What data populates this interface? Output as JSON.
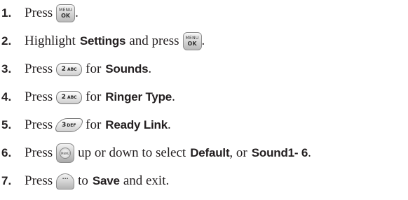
{
  "steps": [
    {
      "number": "1.",
      "parts": [
        "Press",
        "."
      ]
    },
    {
      "number": "2.",
      "parts": [
        "Highlight",
        "Settings",
        "and press",
        "."
      ]
    },
    {
      "number": "3.",
      "parts": [
        "Press",
        "for",
        "Sounds",
        "."
      ]
    },
    {
      "number": "4.",
      "parts": [
        "Press",
        "for",
        "Ringer Type",
        "."
      ]
    },
    {
      "number": "5.",
      "parts": [
        "Press",
        "for",
        "Ready Link",
        "."
      ]
    },
    {
      "number": "6.",
      "parts": [
        "Press",
        "up or down to select",
        "Default",
        ", or",
        "Sound1- 6",
        "."
      ]
    },
    {
      "number": "7.",
      "parts": [
        "Press",
        "to",
        "Save",
        "and exit."
      ]
    }
  ],
  "keys": {
    "menu_ok": {
      "icon": "menu-ok-key-icon",
      "line1": "MENU",
      "line2": "OK"
    },
    "key_2abc": {
      "icon": "key-2abc-icon",
      "digit": "2",
      "letters": "ABC"
    },
    "key_3def": {
      "icon": "key-3def-icon",
      "digit": "3",
      "letters": "DEF"
    },
    "nav_key": {
      "icon": "navigation-key-icon",
      "center": "MENU"
    },
    "softkey": {
      "icon": "left-softkey-icon",
      "glyph": "···"
    }
  }
}
